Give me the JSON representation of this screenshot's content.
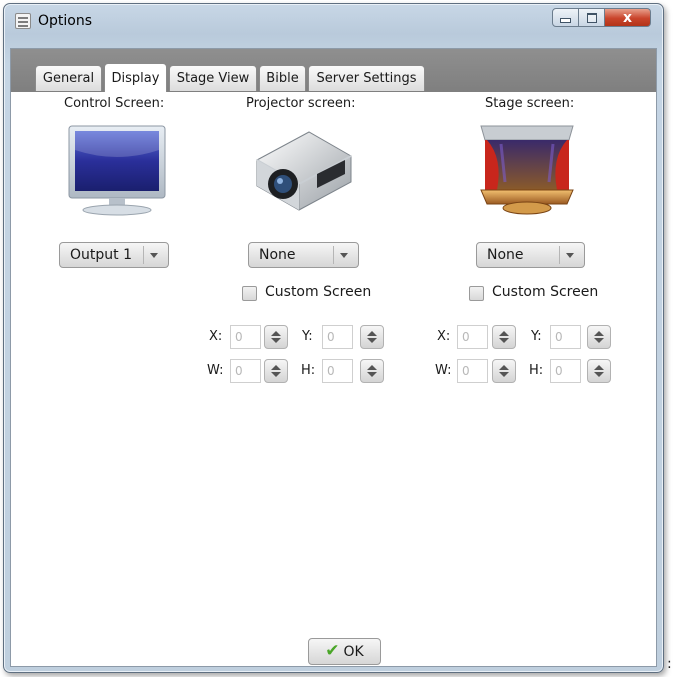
{
  "window": {
    "title": "Options",
    "close_glyph": "x"
  },
  "tabs": [
    {
      "label": "General",
      "active": false
    },
    {
      "label": "Display",
      "active": true
    },
    {
      "label": "Stage View",
      "active": false
    },
    {
      "label": "Bible",
      "active": false
    },
    {
      "label": "Server Settings",
      "active": false
    }
  ],
  "control": {
    "label": "Control Screen:",
    "icon": "monitor-icon",
    "output_value": "Output 1"
  },
  "projector": {
    "label": "Projector screen:",
    "icon": "projector-icon",
    "output_value": "None",
    "custom_label": "Custom Screen",
    "x_label": "X:",
    "x_value": "0",
    "y_label": "Y:",
    "y_value": "0",
    "w_label": "W:",
    "w_value": "0",
    "h_label": "H:",
    "h_value": "0"
  },
  "stage": {
    "label": "Stage screen:",
    "icon": "stage-curtain-icon",
    "output_value": "None",
    "custom_label": "Custom Screen",
    "x_label": "X:",
    "x_value": "0",
    "y_label": "Y:",
    "y_value": "0",
    "w_label": "W:",
    "w_value": "0",
    "h_label": "H:",
    "h_value": "0"
  },
  "ok_label": "OK",
  "trailing_mark": ":",
  "colors": {
    "tab_strip": "#8a8a8a",
    "ok_check": "#4aa628",
    "close_button": "#c9442b"
  }
}
